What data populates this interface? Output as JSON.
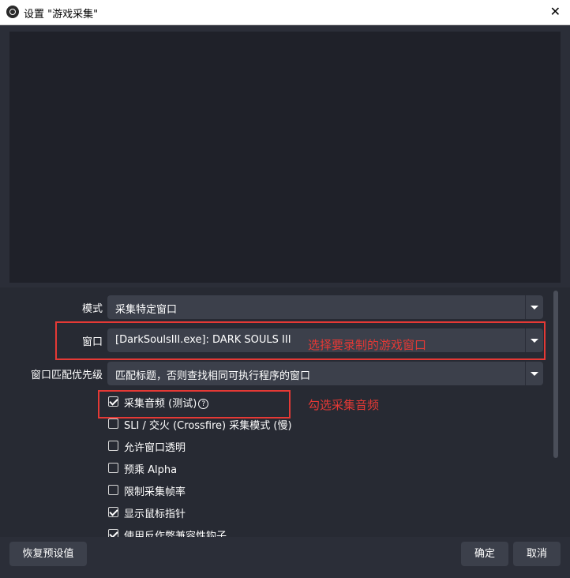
{
  "window": {
    "title": "设置 \"游戏采集\"",
    "close_glyph": "✕"
  },
  "properties": {
    "mode": {
      "label": "模式",
      "value": "采集特定窗口"
    },
    "window": {
      "label": "窗口",
      "value": "[DarkSoulsIII.exe]: DARK SOULS III"
    },
    "match_priority": {
      "label": "窗口匹配优先级",
      "value": "匹配标题，否则查找相同可执行程序的窗口"
    },
    "checkboxes": [
      {
        "label": "采集音频 (测试)",
        "checked": true
      },
      {
        "label": "SLI / 交火 (Crossfire) 采集模式 (慢)",
        "checked": false
      },
      {
        "label": "允许窗口透明",
        "checked": false
      },
      {
        "label": "预乘 Alpha",
        "checked": false
      },
      {
        "label": "限制采集帧率",
        "checked": false
      },
      {
        "label": "显示鼠标指针",
        "checked": true
      },
      {
        "label": "使用反作弊兼容性钩子",
        "checked": true
      }
    ]
  },
  "annotations": {
    "window_hint": "选择要录制的游戏窗口",
    "audio_hint": "勾选采集音频"
  },
  "buttons": {
    "restore": "恢复预设值",
    "ok": "确定",
    "cancel": "取消"
  }
}
